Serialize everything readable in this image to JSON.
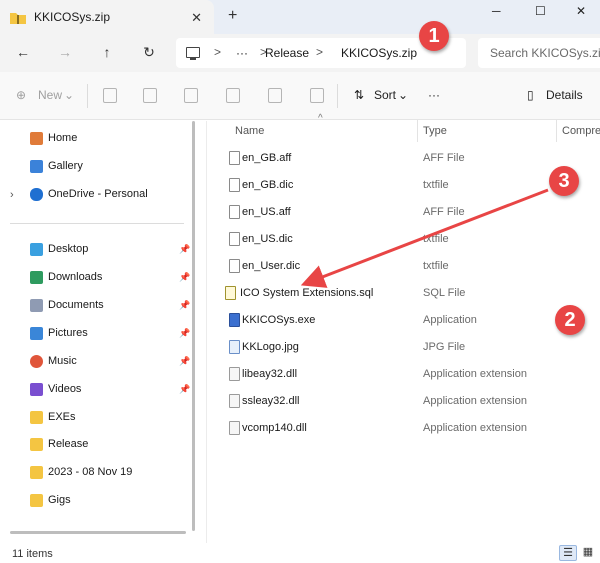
{
  "window": {
    "tab_title": "KKICOSys.zip",
    "tab_close": "✕",
    "new_tab": "+",
    "minimize": "─",
    "maximize": "☐",
    "close": "✕"
  },
  "nav": {
    "back": "←",
    "forward": "→",
    "up": "↑",
    "refresh": "↻"
  },
  "address": {
    "more": "···",
    "separator": ">",
    "crumbs": [
      "Release",
      "KKICOSys.zip"
    ]
  },
  "search": {
    "placeholder": "Search KKICOSys.zip"
  },
  "commandbar": {
    "new_label": "New",
    "new_icon": "⊕",
    "dropdown": "⌄",
    "sort_label": "Sort",
    "sort_icon": "⇅",
    "more": "···",
    "details_label": "Details",
    "details_icon": "▯"
  },
  "sidebar": {
    "expand": "›",
    "pin": "📌",
    "items": [
      {
        "label": "Home",
        "icon": "home-icon",
        "color": "#e07b39"
      },
      {
        "label": "Gallery",
        "icon": "gallery-icon",
        "color": "#3b82d9"
      },
      {
        "label": "OneDrive - Personal",
        "icon": "onedrive-icon",
        "color": "#1f6fd1"
      },
      {
        "label": "Desktop",
        "icon": "desktop-icon",
        "color": "#3aa0e0"
      },
      {
        "label": "Downloads",
        "icon": "download-icon",
        "color": "#2e9b5f"
      },
      {
        "label": "Documents",
        "icon": "documents-icon",
        "color": "#8f9bb3"
      },
      {
        "label": "Pictures",
        "icon": "pictures-icon",
        "color": "#3a86d8"
      },
      {
        "label": "Music",
        "icon": "music-icon",
        "color": "#e0553a"
      },
      {
        "label": "Videos",
        "icon": "videos-icon",
        "color": "#7a4fd0"
      },
      {
        "label": "EXEs",
        "icon": "folder-icon",
        "color": "#f4c542"
      },
      {
        "label": "Release",
        "icon": "folder-icon",
        "color": "#f4c542"
      },
      {
        "label": "2023 - 08 Nov 19",
        "icon": "folder-icon",
        "color": "#f4c542"
      },
      {
        "label": "Gigs",
        "icon": "folder-icon",
        "color": "#f4c542"
      }
    ]
  },
  "columns": {
    "name": "Name",
    "type": "Type",
    "compressed": "Compre",
    "sort_caret": "^"
  },
  "files": [
    {
      "name": "en_GB.aff",
      "type": "AFF File",
      "icon": "file-icon"
    },
    {
      "name": "en_GB.dic",
      "type": "txtfile",
      "icon": "file-icon"
    },
    {
      "name": "en_US.aff",
      "type": "AFF File",
      "icon": "file-icon"
    },
    {
      "name": "en_US.dic",
      "type": "txtfile",
      "icon": "file-icon"
    },
    {
      "name": "en_User.dic",
      "type": "txtfile",
      "icon": "file-icon"
    },
    {
      "name": "ICO System Extensions.sql",
      "type": "SQL File",
      "icon": "sql-file-icon"
    },
    {
      "name": "KKICOSys.exe",
      "type": "Application",
      "icon": "exe-icon"
    },
    {
      "name": "KKLogo.jpg",
      "type": "JPG File",
      "icon": "image-file-icon"
    },
    {
      "name": "libeay32.dll",
      "type": "Application extension",
      "icon": "dll-icon"
    },
    {
      "name": "ssleay32.dll",
      "type": "Application extension",
      "icon": "dll-icon"
    },
    {
      "name": "vcomp140.dll",
      "type": "Application extension",
      "icon": "dll-icon"
    }
  ],
  "status": {
    "item_count": "11 items",
    "details_view": "☰",
    "tiles_view": "▦"
  },
  "annotations": {
    "badge_1": "1",
    "badge_2": "2",
    "badge_3": "3",
    "badge_color": "#e84545"
  }
}
